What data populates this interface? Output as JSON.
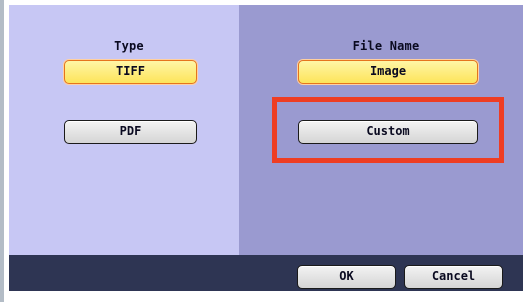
{
  "type_section": {
    "label": "Type",
    "options": [
      {
        "label": "TIFF",
        "selected": true
      },
      {
        "label": "PDF",
        "selected": false
      }
    ]
  },
  "file_name_section": {
    "label": "File Name",
    "options": [
      {
        "label": "Image",
        "selected": true
      },
      {
        "label": "Custom",
        "selected": false,
        "highlighted": true
      }
    ]
  },
  "footer": {
    "ok_label": "OK",
    "cancel_label": "Cancel"
  },
  "colors": {
    "left_panel": "#c7c7f4",
    "right_panel": "#9a9ad0",
    "footer": "#2e3553",
    "selected_button": "#fde45a",
    "selected_border": "#e5751d",
    "callout": "#ee3d23"
  }
}
